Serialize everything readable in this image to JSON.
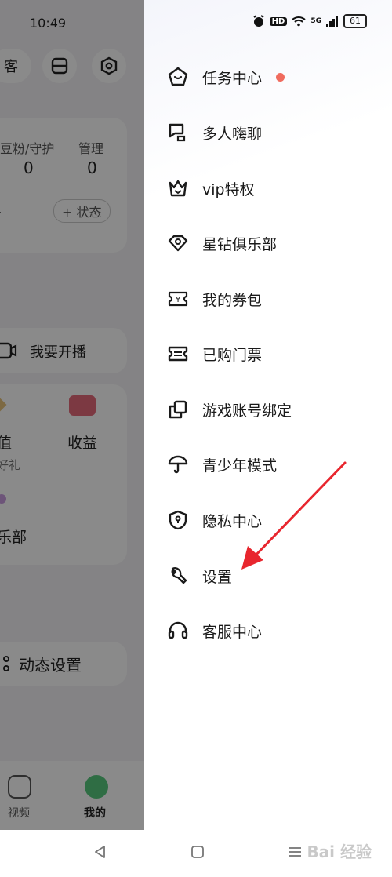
{
  "status_bar": {
    "time": "10:49",
    "hd": "HD",
    "network": "5G",
    "battery": "61"
  },
  "background_app": {
    "top_button_text": "客",
    "stats": [
      {
        "label": "豆粉/守护",
        "value": "0"
      },
      {
        "label": "管理",
        "value": "0"
      }
    ],
    "left_fragment": "号",
    "add_status": "+ 状态",
    "live_button": "我要开播",
    "grid": [
      {
        "label": "值",
        "sub": "好礼"
      },
      {
        "label": "收益",
        "sub": ""
      },
      {
        "label": "乐部",
        "sub": ""
      }
    ],
    "dynamic_settings": "动态设置",
    "bottom_nav": [
      {
        "label": "视频"
      },
      {
        "label": "我的"
      }
    ]
  },
  "drawer": {
    "items": [
      {
        "label": "任务中心",
        "icon": "task-center-icon",
        "badge": true
      },
      {
        "label": "多人嗨聊",
        "icon": "group-chat-icon"
      },
      {
        "label": "vip特权",
        "icon": "vip-crown-icon"
      },
      {
        "label": "星钻俱乐部",
        "icon": "diamond-club-icon"
      },
      {
        "label": "我的券包",
        "icon": "coupon-icon"
      },
      {
        "label": "已购门票",
        "icon": "ticket-icon"
      },
      {
        "label": "游戏账号绑定",
        "icon": "game-account-icon"
      },
      {
        "label": "青少年模式",
        "icon": "umbrella-icon"
      },
      {
        "label": "隐私中心",
        "icon": "privacy-shield-icon"
      },
      {
        "label": "设置",
        "icon": "wrench-icon"
      },
      {
        "label": "客服中心",
        "icon": "headset-icon"
      }
    ]
  },
  "colors": {
    "badge": "#f06b5e",
    "arrow": "#e8262e"
  },
  "watermark": "Bai 经验"
}
